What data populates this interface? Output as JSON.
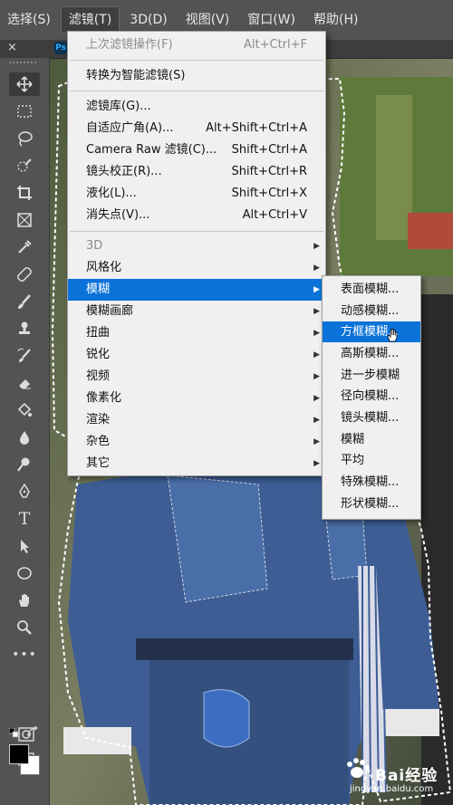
{
  "menubar": {
    "items": [
      {
        "label": "选择(S)"
      },
      {
        "label": "滤镜(T)"
      },
      {
        "label": "3D(D)"
      },
      {
        "label": "视图(V)"
      },
      {
        "label": "窗口(W)"
      },
      {
        "label": "帮助(H)"
      }
    ]
  },
  "tabstrip": {
    "close": "×",
    "ps_icon": "Ps"
  },
  "filter_menu": {
    "last_filter": {
      "label": "上次滤镜操作(F)",
      "shortcut": "Alt+Ctrl+F"
    },
    "smart": {
      "label": "转换为智能滤镜(S)"
    },
    "gallery": {
      "label": "滤镜库(G)..."
    },
    "adaptive": {
      "label": "自适应广角(A)...",
      "shortcut": "Alt+Shift+Ctrl+A"
    },
    "camera_raw": {
      "label": "Camera Raw 滤镜(C)...",
      "shortcut": "Shift+Ctrl+A"
    },
    "lens": {
      "label": "镜头校正(R)...",
      "shortcut": "Shift+Ctrl+R"
    },
    "liquify": {
      "label": "液化(L)...",
      "shortcut": "Shift+Ctrl+X"
    },
    "vanishing": {
      "label": "消失点(V)...",
      "shortcut": "Alt+Ctrl+V"
    },
    "d3": {
      "label": "3D"
    },
    "stylize": {
      "label": "风格化"
    },
    "blur": {
      "label": "模糊"
    },
    "blur_gallery": {
      "label": "模糊画廊"
    },
    "distort": {
      "label": "扭曲"
    },
    "sharpen": {
      "label": "锐化"
    },
    "video": {
      "label": "视频"
    },
    "pixelate": {
      "label": "像素化"
    },
    "render": {
      "label": "渲染"
    },
    "noise": {
      "label": "杂色"
    },
    "other": {
      "label": "其它"
    }
  },
  "blur_submenu": {
    "items": [
      {
        "label": "表面模糊..."
      },
      {
        "label": "动感模糊..."
      },
      {
        "label": "方框模糊..."
      },
      {
        "label": "高斯模糊..."
      },
      {
        "label": "进一步模糊"
      },
      {
        "label": "径向模糊..."
      },
      {
        "label": "镜头模糊..."
      },
      {
        "label": "模糊"
      },
      {
        "label": "平均"
      },
      {
        "label": "特殊模糊..."
      },
      {
        "label": "形状模糊..."
      }
    ],
    "highlighted_index": 2
  },
  "watermark": {
    "brand": "Bai经验",
    "url": "jingyan.baidu.com"
  },
  "colors": {
    "accent": "#0a72d8",
    "menu_bg": "#f0f0f0",
    "ui_bg": "#535353"
  }
}
